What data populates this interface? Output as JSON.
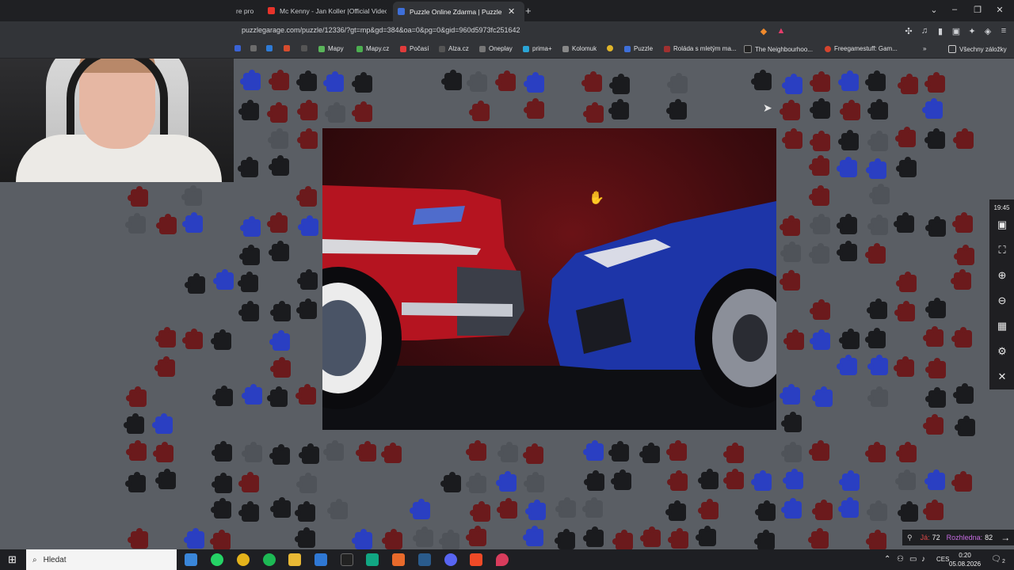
{
  "browser": {
    "tabs": [
      {
        "label": "re pro",
        "active": false
      },
      {
        "label": "Mc Kenny - Jan Koller |Official Video|",
        "active": false
      },
      {
        "label": "Puzzle Online Zdarma | Puzzle G",
        "active": true
      }
    ],
    "new_tab": "+",
    "url": "puzzlegarage.com/puzzle/12336/?gt=mp&gd=384&oa=0&pg=0&gid=960d5973fc251642",
    "bookmarks": [
      "Mapy",
      "Mapy.cz",
      "Počasí",
      "Alza.cz",
      "Oneplay",
      "prima+",
      "Kolomuk",
      "Puzzle",
      "Roláda s mletým ma...",
      "The Neighbourhoo...",
      "Freegamestuff: Gam..."
    ],
    "all_bookmarks": "Všechny záložky"
  },
  "game": {
    "time": "19:45",
    "tools": [
      "image-icon",
      "fullscreen-icon",
      "zoom-in-icon",
      "zoom-out-icon",
      "grid-icon",
      "settings-icon",
      "close-icon"
    ],
    "status": {
      "player_label": "Já:",
      "player_value": "72",
      "total_label": "Rozhledna:",
      "total_value": "82"
    }
  },
  "taskbar": {
    "search_placeholder": "Hledat",
    "language": "CES",
    "time": "0:20",
    "date": "05.08.2026",
    "notifications": "2"
  },
  "colors": {
    "piece_red": "#6b1a1c",
    "piece_blue": "#2a3fc2",
    "piece_dark": "#1a1b1e",
    "piece_grey": "#4f5359"
  }
}
